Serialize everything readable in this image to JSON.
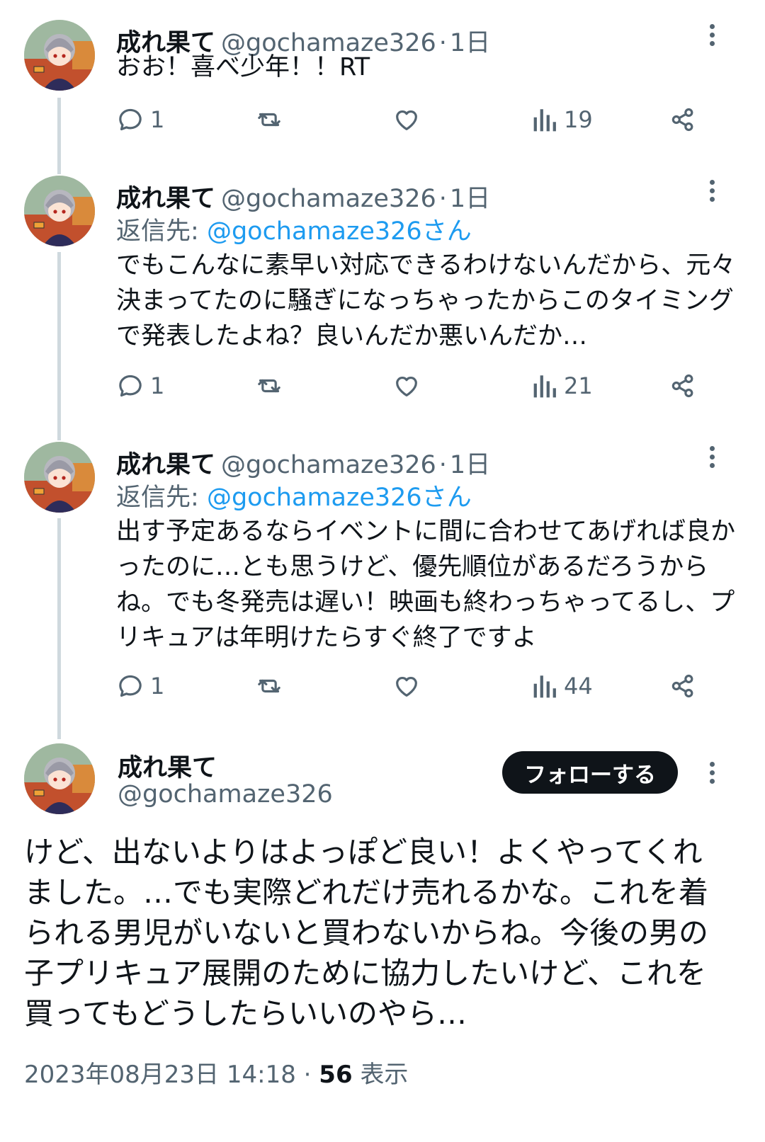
{
  "thread": [
    {
      "name": "成れ果て",
      "handle": "@gochamaze326",
      "dot": "·",
      "time": "1日",
      "reply_prefix": "",
      "reply_to": "",
      "lines": [
        "おお！喜べ少年！！RT"
      ],
      "replies": "1",
      "views": "19"
    },
    {
      "name": "成れ果て",
      "handle": "@gochamaze326",
      "dot": "·",
      "time": "1日",
      "reply_prefix": "返信先:",
      "reply_to": "@gochamaze326さん",
      "lines": [
        "でもこんなに素早い対応できるわけないんだから、元々",
        "決まってたのに騒ぎになっちゃったからこのタイミング",
        "で発表したよね？良いんだか悪いんだか…"
      ],
      "replies": "1",
      "views": "21"
    },
    {
      "name": "成れ果て",
      "handle": "@gochamaze326",
      "dot": "·",
      "time": "1日",
      "reply_prefix": "返信先:",
      "reply_to": "@gochamaze326さん",
      "lines": [
        "出す予定あるならイベントに間に合わせてあげれば良か",
        "ったのに…とも思うけど、優先順位があるだろうから",
        "ね。でも冬発売は遅い！映画も終わっちゃってるし、プ",
        "リキュアは年明けたらすぐ終了ですよ"
      ],
      "replies": "1",
      "views": "44"
    }
  ],
  "focus": {
    "name": "成れ果て",
    "handle": "@gochamaze326",
    "follow_label": "フォローする",
    "lines": [
      "けど、出ないよりはよっぽど良い！よくやってくれ",
      "ました。…でも実際どれだけ売れるかな。これを着",
      "られる男児がいないと買わないからね。今後の男の",
      "子プリキュア展開のために協力したいけど、これを",
      "買ってもどうしたらいいのやら…"
    ],
    "timestamp": "2023年08月23日 14:18",
    "separator": "·",
    "views_count": "56",
    "views_label": "表示"
  },
  "icons": {
    "reply": "reply-icon",
    "retweet": "retweet-icon",
    "like": "heart-icon",
    "views": "views-icon",
    "share": "share-icon",
    "more": "more-icon"
  },
  "colors": {
    "link": "#1d9bf0",
    "muted": "#536471",
    "text": "#0f1419",
    "thread_line": "#cfd9de",
    "button_bg": "#0f1419"
  }
}
